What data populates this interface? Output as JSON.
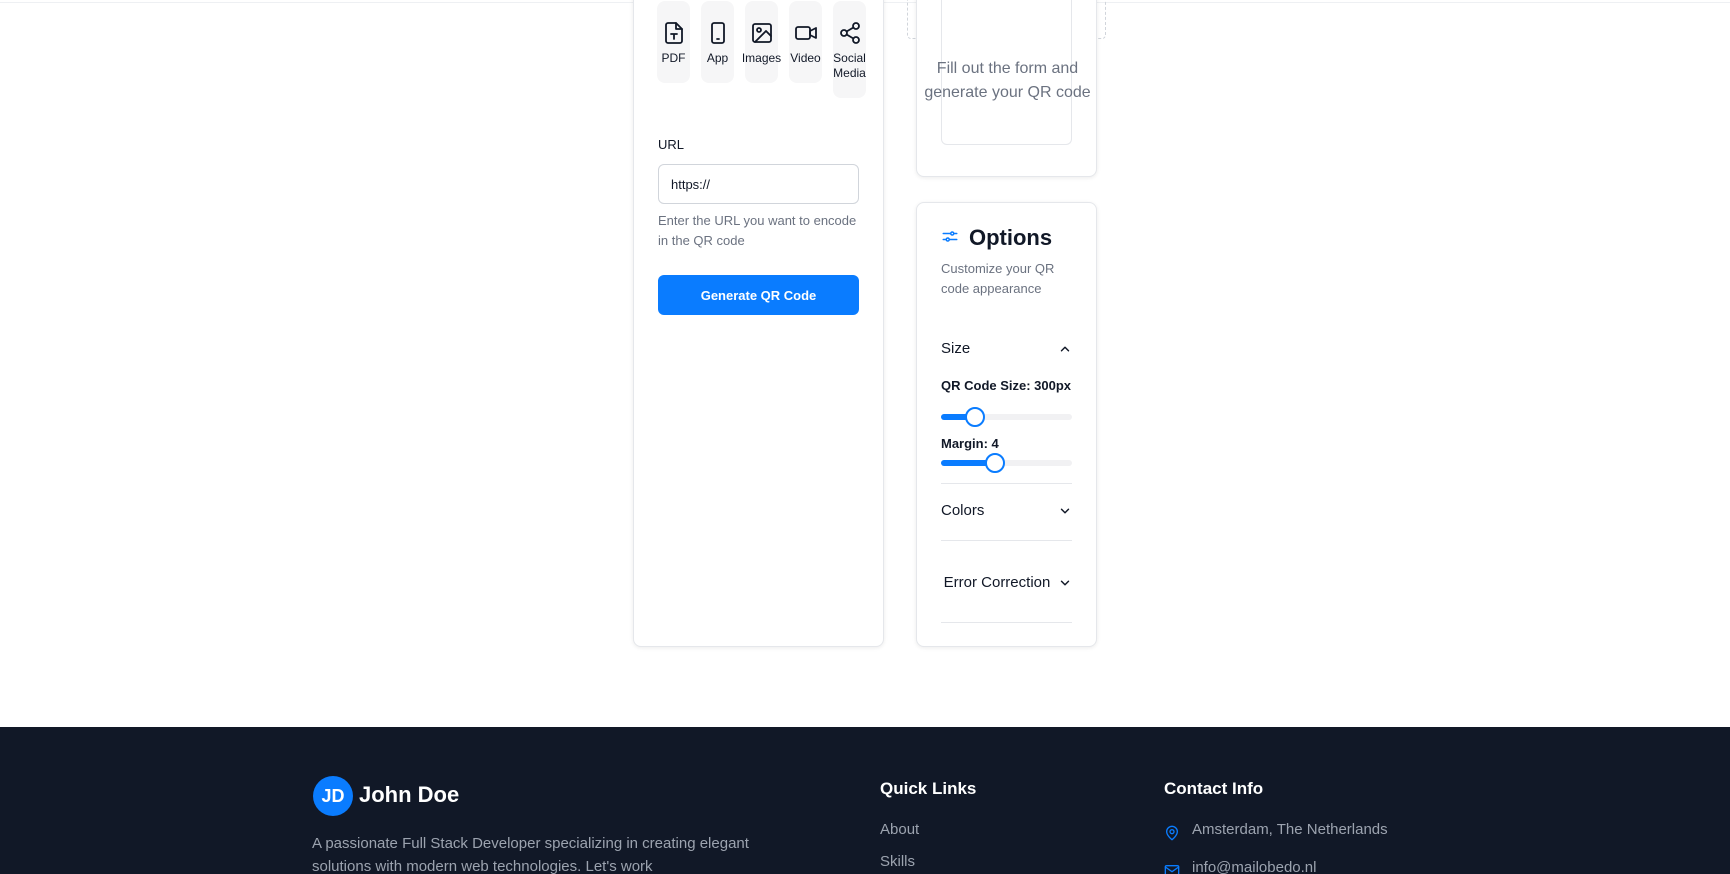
{
  "qr_types": [
    {
      "label": "PDF",
      "icon": "pdf-icon"
    },
    {
      "label": "App",
      "icon": "mobile-icon"
    },
    {
      "label": "Images",
      "icon": "image-icon"
    },
    {
      "label": "Video",
      "icon": "video-icon"
    },
    {
      "label": "Social Media",
      "icon": "share-icon"
    }
  ],
  "form": {
    "url_label": "URL",
    "url_value": "https://",
    "url_help": "Enter the URL you want to encode in the QR code",
    "generate_label": "Generate QR Code"
  },
  "preview": {
    "placeholder_text": "Fill out the form and generate your QR code"
  },
  "options": {
    "title": "Options",
    "subtitle": "Customize your QR code appearance",
    "size_section": {
      "title": "Size",
      "expanded": true,
      "qr_size_label": "QR Code Size: 300px",
      "qr_size_fraction": 0.26,
      "margin_label": "Margin: 4",
      "margin_fraction": 0.41
    },
    "colors_section": {
      "title": "Colors",
      "expanded": false
    },
    "error_section": {
      "title": "Error Correction",
      "expanded": false
    }
  },
  "footer": {
    "avatar_initials": "JD",
    "name": "John Doe",
    "description": "A passionate Full Stack Developer specializing in creating elegant solutions with modern web technologies. Let's work",
    "quick_links_title": "Quick Links",
    "quick_links": [
      "About",
      "Skills"
    ],
    "contact_title": "Contact Info",
    "location": "Amsterdam, The Netherlands",
    "email": "info@mailobedo.nl"
  },
  "colors": {
    "accent": "#0a7cff",
    "footer_bg": "#111827"
  }
}
